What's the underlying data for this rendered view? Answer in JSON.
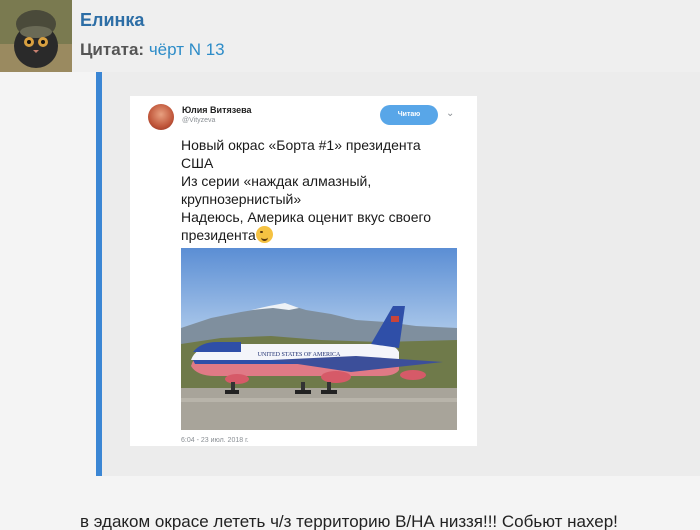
{
  "author": {
    "name": "Елинка"
  },
  "quote": {
    "label": "Цитата:",
    "author": "чёрт N 13"
  },
  "tweet": {
    "name": "Юлия Витязева",
    "handle": "@Vityzeva",
    "follow_label": "Читаю",
    "lines": [
      "Новый окрас «Борта #1» президента",
      "США",
      "Из серии «наждак алмазный,",
      "крупнозернистый»",
      "Надеюсь, Америка оценит вкус своего",
      "президента"
    ],
    "image_caption": "UNITED STATES OF AMERICA",
    "date": "6:04 - 23 июл. 2018 г."
  },
  "comment": "в эдаком окрасе лететь ч/з территорию В/НА низзя!!! Собьют нахер!",
  "colors": {
    "author": "#2d6ea6",
    "quote_link": "#2d8cc8",
    "quote_bar": "#3b86d4",
    "follow_button": "#58a6e8"
  },
  "icons": {
    "tweet_menu": "chevron-down-icon",
    "emoji": "winking-face-icon"
  }
}
